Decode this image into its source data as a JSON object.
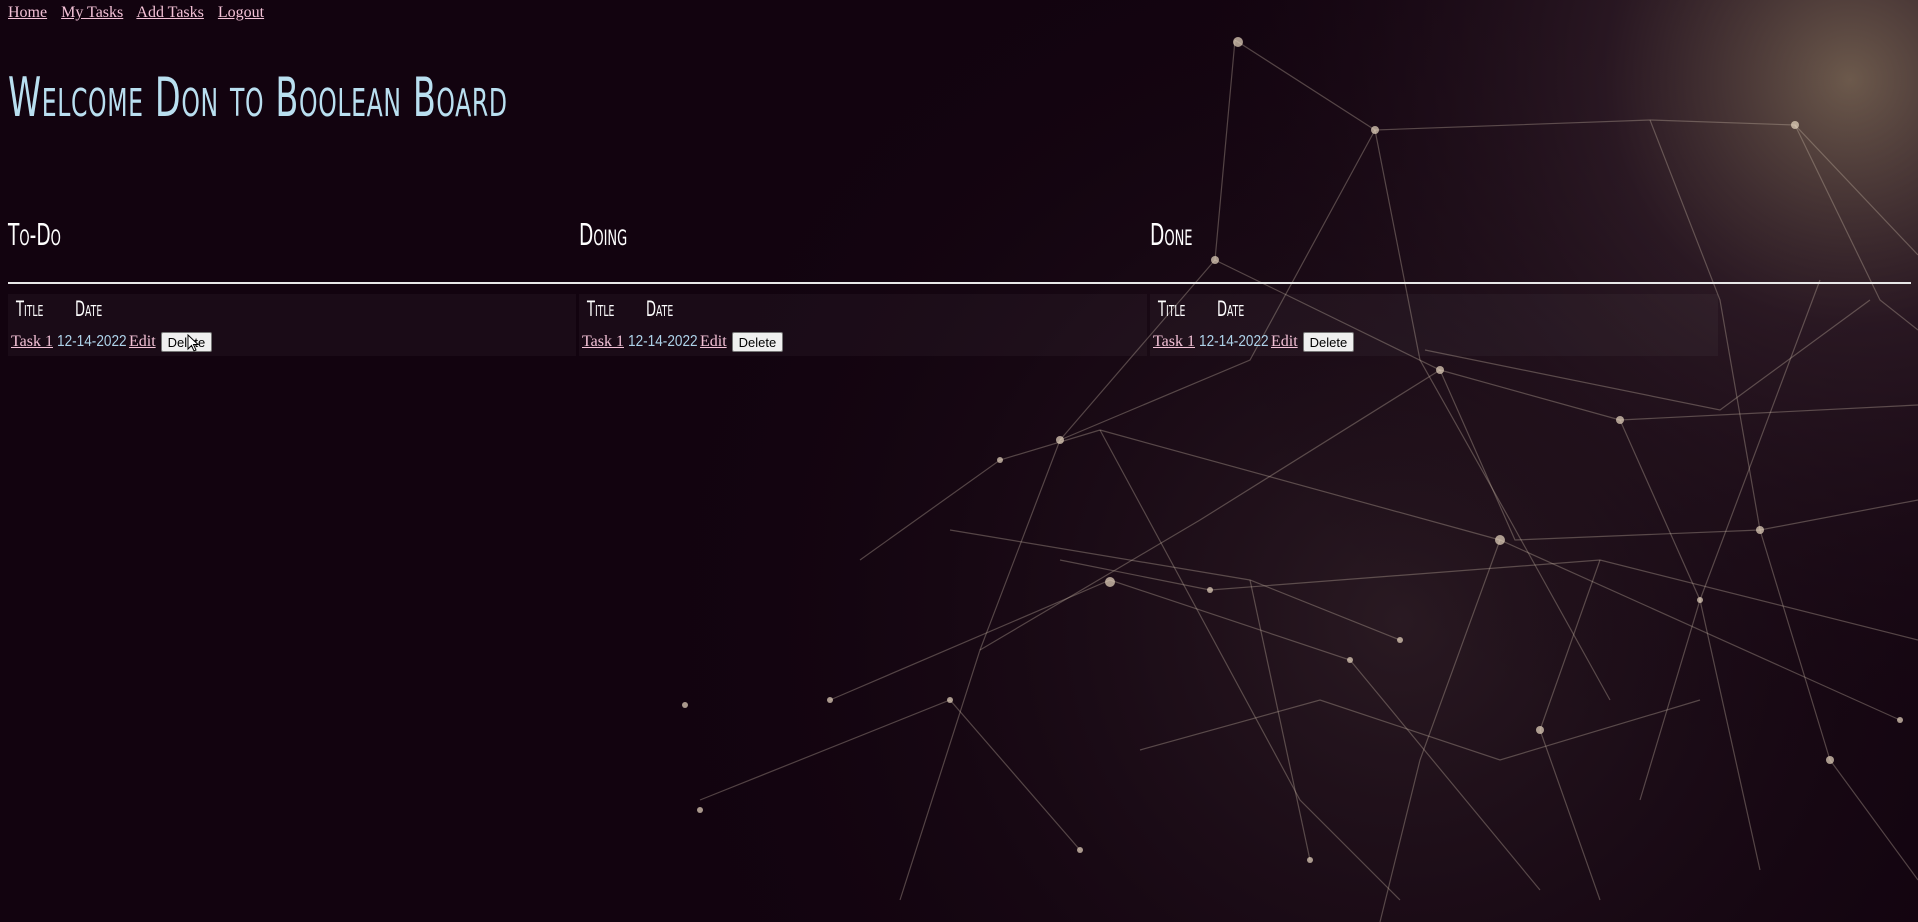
{
  "nav": {
    "links": [
      "Home",
      "My Tasks",
      "Add Tasks",
      "Logout"
    ]
  },
  "header": {
    "welcome": "Welcome Don to Boolean Board"
  },
  "columns": [
    {
      "title": "To-Do",
      "headers": [
        "Title",
        "Date"
      ],
      "task": {
        "title": "Task 1",
        "date": "12-14-2022",
        "edit": "Edit",
        "delete": "Delete"
      }
    },
    {
      "title": "Doing",
      "headers": [
        "Title",
        "Date"
      ],
      "task": {
        "title": "Task 1",
        "date": "12-14-2022",
        "edit": "Edit",
        "delete": "Delete"
      }
    },
    {
      "title": "Done",
      "headers": [
        "Title",
        "Date"
      ],
      "task": {
        "title": "Task 1",
        "date": "12-14-2022",
        "edit": "Edit",
        "delete": "Delete"
      }
    }
  ],
  "colors": {
    "background": "#12030f",
    "link": "#f3c1d6",
    "heading": "#b9dff0",
    "date": "#aed3ea"
  }
}
